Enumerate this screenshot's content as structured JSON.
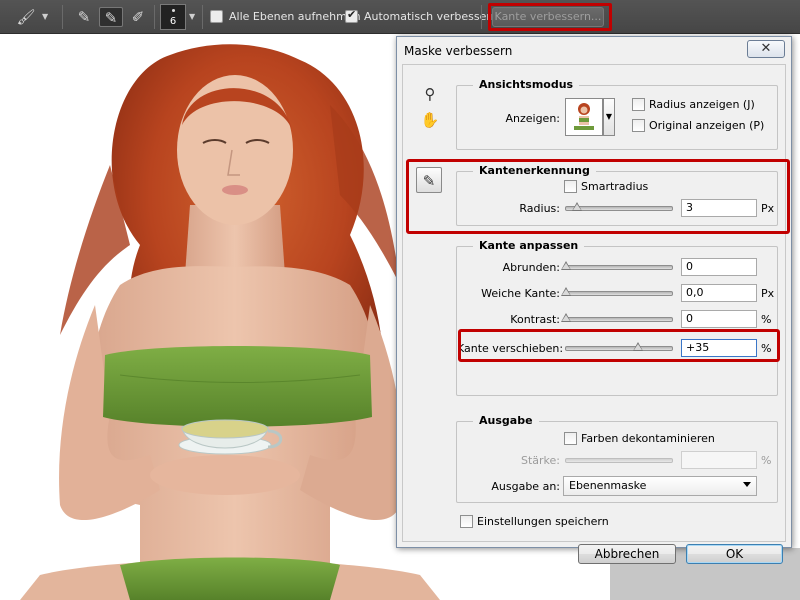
{
  "toolbar": {
    "brush_size": "6",
    "sample_all_layers": {
      "label": "Alle Ebenen aufnehmen",
      "checked": false
    },
    "auto_enhance": {
      "label": "Automatisch verbessern",
      "checked": true
    },
    "refine_edge_button": "Kante verbessern..."
  },
  "dialog": {
    "title": "Maske verbessern",
    "close_label": "✕",
    "view_mode": {
      "title": "Ansichtsmodus",
      "show_label": "Anzeigen:",
      "show_radius": {
        "label": "Radius anzeigen (J)",
        "checked": false
      },
      "show_original": {
        "label": "Original anzeigen (P)",
        "checked": false
      }
    },
    "edge_detection": {
      "title": "Kantenerkennung",
      "smart_radius": {
        "label": "Smartradius",
        "checked": false
      },
      "radius": {
        "label": "Radius:",
        "value": "3",
        "unit": "Px",
        "slider_fraction": 0.1
      }
    },
    "adjust_edge": {
      "title": "Kante anpassen",
      "smooth": {
        "label": "Abrunden:",
        "value": "0",
        "unit": "",
        "slider_fraction": 0.0
      },
      "feather": {
        "label": "Weiche Kante:",
        "value": "0,0",
        "unit": "Px",
        "slider_fraction": 0.0
      },
      "contrast": {
        "label": "Kontrast:",
        "value": "0",
        "unit": "%",
        "slider_fraction": 0.0
      },
      "shift_edge": {
        "label": "Kante verschieben:",
        "value": "+35",
        "unit": "%",
        "slider_fraction": 0.675
      }
    },
    "output": {
      "title": "Ausgabe",
      "decontaminate": {
        "label": "Farben dekontaminieren",
        "checked": false
      },
      "amount": {
        "label": "Stärke:",
        "value": "",
        "unit": "%"
      },
      "output_to_label": "Ausgabe an:",
      "output_to_value": "Ebenenmaske"
    },
    "remember_settings": {
      "label": "Einstellungen speichern",
      "checked": false
    },
    "cancel_label": "Abbrechen",
    "ok_label": "OK"
  },
  "colors": {
    "highlight_red": "#c10000",
    "hair": "#b8441f",
    "skin": "#e7bba3",
    "top_green": "#6e9a3a"
  },
  "icons": [
    "brush-icon",
    "quick-selection-icon",
    "add-selection-icon",
    "subtract-selection-icon",
    "zoom-icon",
    "hand-icon",
    "refine-radius-brush-icon"
  ]
}
